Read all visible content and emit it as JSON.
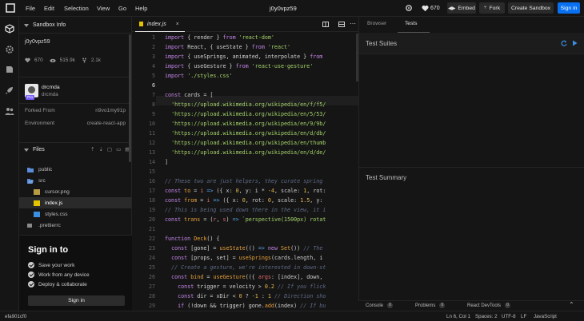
{
  "topbar": {
    "menu": [
      "File",
      "Edit",
      "Selection",
      "View",
      "Go",
      "Help"
    ],
    "sandbox_name": "j0y0vpz59",
    "likes": "670",
    "embed_label": "Embed",
    "fork_label": "Fork",
    "create_label": "Create Sandbox",
    "signin_label": "Sign in"
  },
  "sidebar": {
    "info_header": "Sandbox Info",
    "sandbox_title": "j0y0vpz59",
    "stats": {
      "likes": "670",
      "views": "515.9k",
      "forks": "2.1k"
    },
    "author": {
      "name": "drcmda",
      "handle": "drcmda",
      "badge": "Pro"
    },
    "forked_from_label": "Forked From",
    "forked_from_value": "n9vo1my91p",
    "environment_label": "Environment",
    "environment_value": "create-react-app",
    "files_header": "Files",
    "files": [
      {
        "name": "public",
        "type": "folder",
        "depth": 0
      },
      {
        "name": "src",
        "type": "folder-open",
        "depth": 0
      },
      {
        "name": "cursor.png",
        "type": "image",
        "depth": 1
      },
      {
        "name": "index.js",
        "type": "js",
        "depth": 1,
        "active": true
      },
      {
        "name": "styles.css",
        "type": "css",
        "depth": 1
      },
      {
        "name": ".prettierrc",
        "type": "config",
        "depth": 0
      }
    ]
  },
  "signin_panel": {
    "title": "Sign in to",
    "bullets": [
      "Save your work",
      "Work from any device",
      "Deploy & collaborate"
    ],
    "button_label": "Sign in"
  },
  "editor": {
    "tab_label": "index.js",
    "current_line": 6
  },
  "right": {
    "tabs": [
      "Browser",
      "Tests"
    ],
    "tests_title": "Test Suites",
    "summary_title": "Test Summary"
  },
  "devtools": {
    "tabs": [
      {
        "label": "Console",
        "count": "0"
      },
      {
        "label": "Problems",
        "count": "0"
      },
      {
        "label": "React DevTools",
        "count": "0"
      }
    ]
  },
  "statusbar": {
    "commit": "efa901cf0",
    "position": "Ln 6, Col 1",
    "spaces": "Spaces: 2",
    "encoding": "UTF-8",
    "eol": "LF",
    "language": "JavaScript"
  },
  "colors": {
    "accent": "#0971f1",
    "bg": "#151515",
    "panel": "#1c1c1c"
  }
}
